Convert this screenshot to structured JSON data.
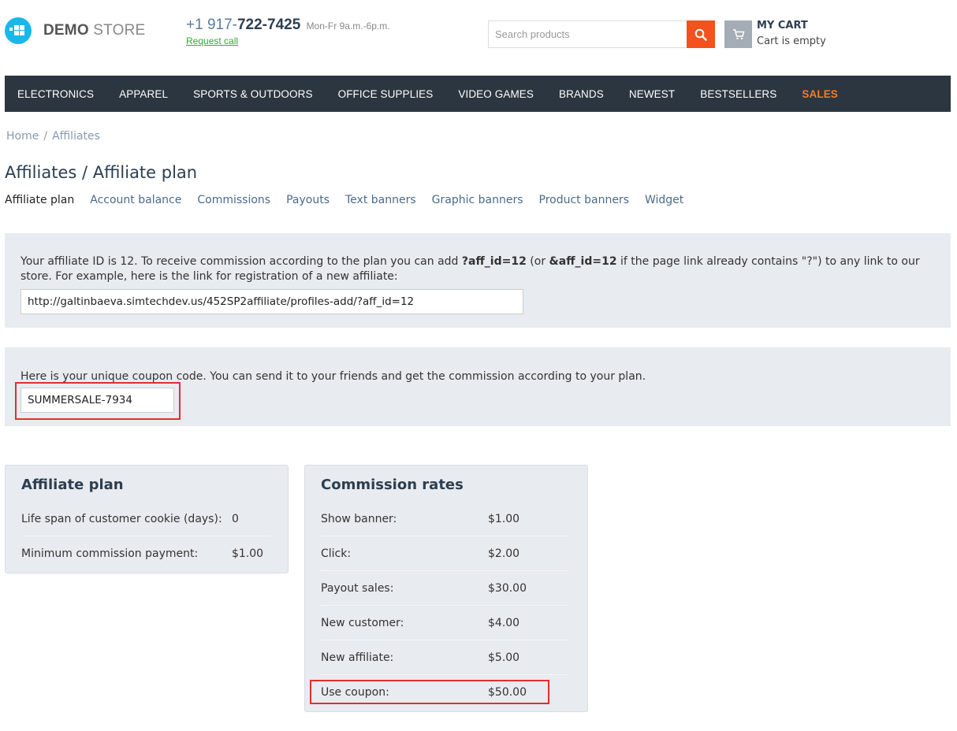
{
  "header": {
    "logo": {
      "bold": "DEMO",
      "light": "STORE"
    },
    "phone": {
      "prefix": "+1 917-",
      "number": "722-7425",
      "hours": "Mon-Fr 9a.m.-6p.m."
    },
    "request_call": "Request call",
    "search": {
      "placeholder": "Search products"
    },
    "cart": {
      "title": "MY CART",
      "status": "Cart is empty"
    }
  },
  "nav": {
    "items": [
      "ELECTRONICS",
      "APPAREL",
      "SPORTS & OUTDOORS",
      "OFFICE SUPPLIES",
      "VIDEO GAMES",
      "BRANDS",
      "NEWEST",
      "BESTSELLERS",
      "SALES"
    ]
  },
  "breadcrumb": {
    "home": "Home",
    "separator": "/",
    "current": "Affiliates"
  },
  "page": {
    "title": "Affiliates / Affiliate plan"
  },
  "tabs": [
    "Affiliate plan",
    "Account balance",
    "Commissions",
    "Payouts",
    "Text banners",
    "Graphic banners",
    "Product banners",
    "Widget"
  ],
  "affiliate_info": {
    "text_1": "Your affiliate ID is 12. To receive commission according to the plan you can add ",
    "param_1": "?aff_id=12",
    "text_2": " (or ",
    "param_2": "&aff_id=12",
    "text_3": " if the page link already contains \"?\") to any link to our store. For example, here is the link for registration of a new affiliate:",
    "link": "http://galtinbaeva.simtechdev.us/452SP2affiliate/profiles-add/?aff_id=12"
  },
  "coupon": {
    "text": "Here is your unique coupon code. You can send it to your friends and get the commission according to your plan.",
    "code": "SUMMERSALE-7934"
  },
  "affiliate_plan": {
    "title": "Affiliate plan",
    "rows": [
      {
        "label": "Life span of customer cookie (days):",
        "value": "0"
      },
      {
        "label": "Minimum commission payment:",
        "value": "$1.00"
      }
    ]
  },
  "commission_rates": {
    "title": "Commission rates",
    "rows": [
      {
        "label": "Show banner:",
        "value": "$1.00"
      },
      {
        "label": "Click:",
        "value": "$2.00"
      },
      {
        "label": "Payout sales:",
        "value": "$30.00"
      },
      {
        "label": "New customer:",
        "value": "$4.00"
      },
      {
        "label": "New affiliate:",
        "value": "$5.00"
      },
      {
        "label": "Use coupon:",
        "value": "$50.00"
      }
    ]
  },
  "colors": {
    "accent": "#f4511e",
    "nav_bg": "#2c3640",
    "sales": "#f47e20",
    "highlight": "#e03030",
    "panel_bg": "#e8ebef"
  }
}
